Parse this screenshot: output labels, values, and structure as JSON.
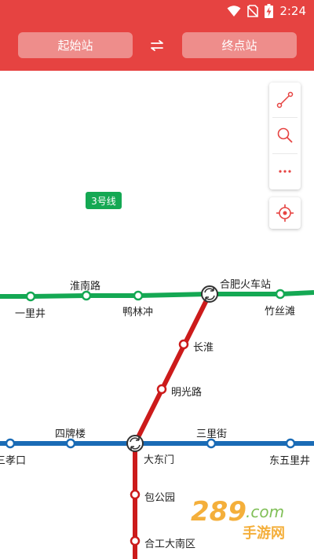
{
  "status_bar": {
    "time": "2:24"
  },
  "header": {
    "start_station": "起始站",
    "end_station": "终点站",
    "swap_icon": "swap-arrows-icon"
  },
  "toolbar": {
    "items": [
      "route-icon",
      "search-icon",
      "more-icon"
    ],
    "locate": "locate-icon"
  },
  "map": {
    "line3_badge": "3号线",
    "stations": {
      "yilijing": "一里井",
      "huainanlu": "淮南路",
      "yalinchong": "鸭林冲",
      "hefeihuochezhan": "合肥火车站",
      "zhusitan": "竹丝滩",
      "changhuai": "长淮",
      "mingguanglu": "明光路",
      "sipailou": "四牌楼",
      "sanlijie": "三里街",
      "xiaokou": "三孝口",
      "dadongmen": "大东门",
      "dongwulijing": "东五里井",
      "baogongyuan": "包公园",
      "hegongdananqu": "合工大南区"
    },
    "line_colors": {
      "line1": "#cc1b1b",
      "line2": "#1a6bb5",
      "line3": "#14a853"
    }
  },
  "watermark": {
    "number": "289",
    "domain": ".com",
    "subtitle": "手游网"
  }
}
